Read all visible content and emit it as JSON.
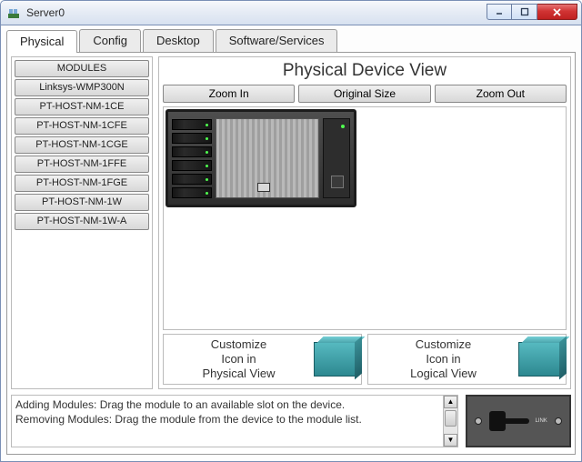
{
  "window": {
    "title": "Server0",
    "min_label": "–",
    "max_label": "▢",
    "close_label": "×"
  },
  "tabs": [
    {
      "label": "Physical",
      "active": true
    },
    {
      "label": "Config",
      "active": false
    },
    {
      "label": "Desktop",
      "active": false
    },
    {
      "label": "Software/Services",
      "active": false
    }
  ],
  "modules": {
    "header": "MODULES",
    "items": [
      "Linksys-WMP300N",
      "PT-HOST-NM-1CE",
      "PT-HOST-NM-1CFE",
      "PT-HOST-NM-1CGE",
      "PT-HOST-NM-1FFE",
      "PT-HOST-NM-1FGE",
      "PT-HOST-NM-1W",
      "PT-HOST-NM-1W-A"
    ]
  },
  "device": {
    "title": "Physical Device View",
    "zoom_in": "Zoom In",
    "original": "Original Size",
    "zoom_out": "Zoom Out"
  },
  "customize": {
    "physical_line1": "Customize",
    "physical_line2": "Icon in",
    "physical_line3": "Physical View",
    "logical_line1": "Customize",
    "logical_line2": "Icon in",
    "logical_line3": "Logical View"
  },
  "help": {
    "line1": "Adding Modules: Drag the module to an available slot on the device.",
    "line2": "Removing Modules: Drag the module from the device to the module list."
  },
  "preview": {
    "link_label": "LINK"
  }
}
